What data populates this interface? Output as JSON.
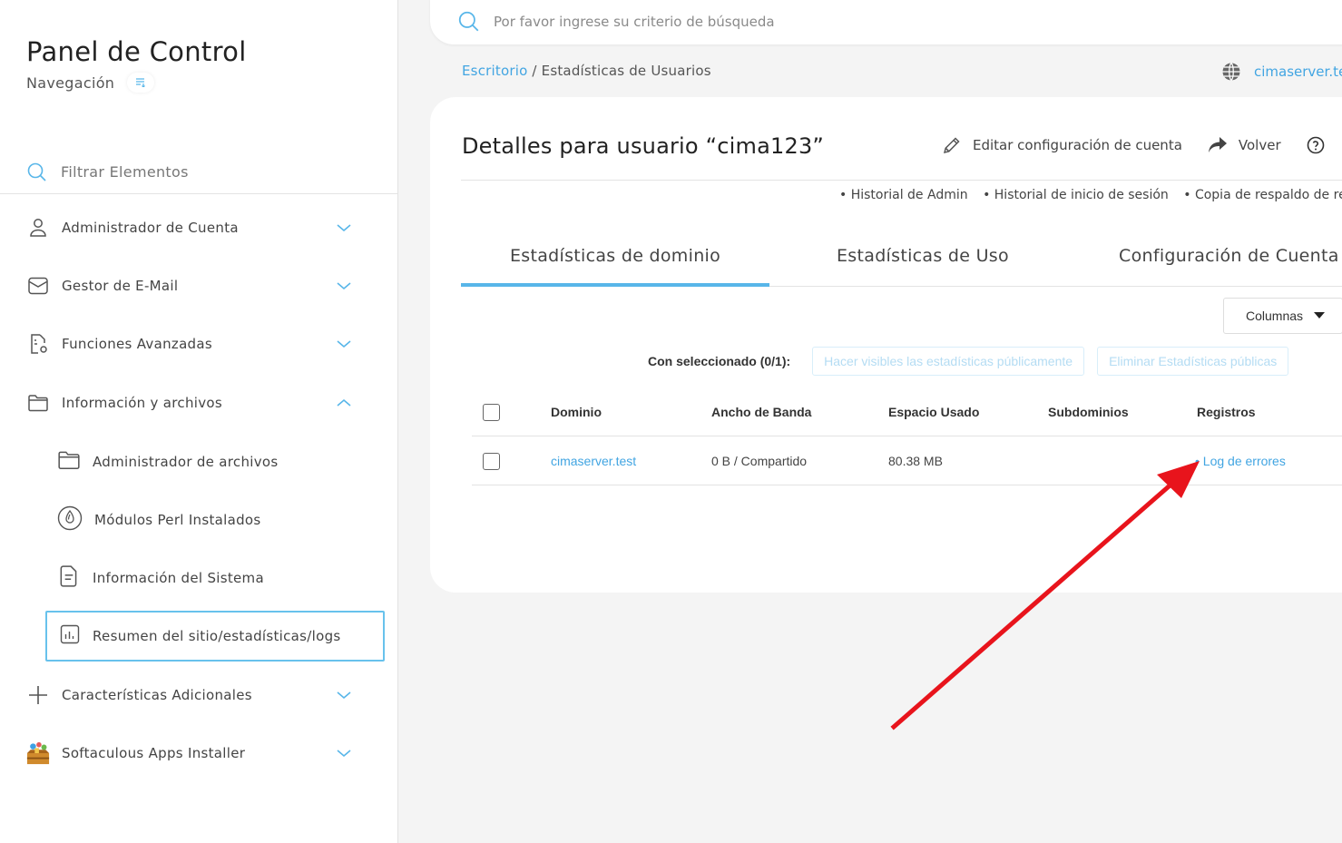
{
  "sidebar": {
    "title": "Panel de Control",
    "subtitle": "Navegación",
    "filter_placeholder": "Filtrar Elementos",
    "items": [
      {
        "label": "Administrador de Cuenta"
      },
      {
        "label": "Gestor de E-Mail"
      },
      {
        "label": "Funciones Avanzadas"
      },
      {
        "label": "Información y archivos"
      },
      {
        "label": "Características Adicionales"
      },
      {
        "label": "Softaculous Apps Installer"
      }
    ],
    "subitems": [
      {
        "label": "Administrador de archivos"
      },
      {
        "label": "Módulos Perl Instalados"
      },
      {
        "label": "Información del Sistema"
      },
      {
        "label": "Resumen del sitio/estadísticas/logs"
      }
    ]
  },
  "search": {
    "placeholder": "Por favor ingrese su criterio de búsqueda"
  },
  "breadcrumb": {
    "home": "Escritorio",
    "separator": " / ",
    "current": "Estadísticas de Usuarios"
  },
  "server": {
    "name": "cimaserver.test"
  },
  "page": {
    "title": "Detalles para usuario “cima123”",
    "actions": {
      "edit": "Editar configuración de cuenta",
      "back": "Volver"
    },
    "links": [
      "• Historial de Admin",
      "• Historial de inicio de sesión",
      "• Copia de respaldo de registros"
    ]
  },
  "tabs": [
    {
      "label": "Estadísticas de dominio",
      "active": true
    },
    {
      "label": "Estadísticas de Uso",
      "active": false
    },
    {
      "label": "Configuración de Cuenta",
      "active": false
    }
  ],
  "columns_button": "Columnas",
  "bulk": {
    "label": "Con seleccionado (0/1):",
    "make_public": "Hacer visibles las estadísticas públicamente",
    "delete_public": "Eliminar Estadísticas públicas"
  },
  "table": {
    "headers": [
      "Dominio",
      "Ancho de Banda",
      "Espacio Usado",
      "Subdominios",
      "Registros"
    ],
    "rows": [
      {
        "domain": "cimaserver.test",
        "bandwidth": "0 B / Compartido",
        "space": "80.38 MB",
        "subdomains": "",
        "logs": "• Log de errores"
      }
    ]
  },
  "colors": {
    "accent": "#42a5e2",
    "arrow": "#e8141c"
  }
}
